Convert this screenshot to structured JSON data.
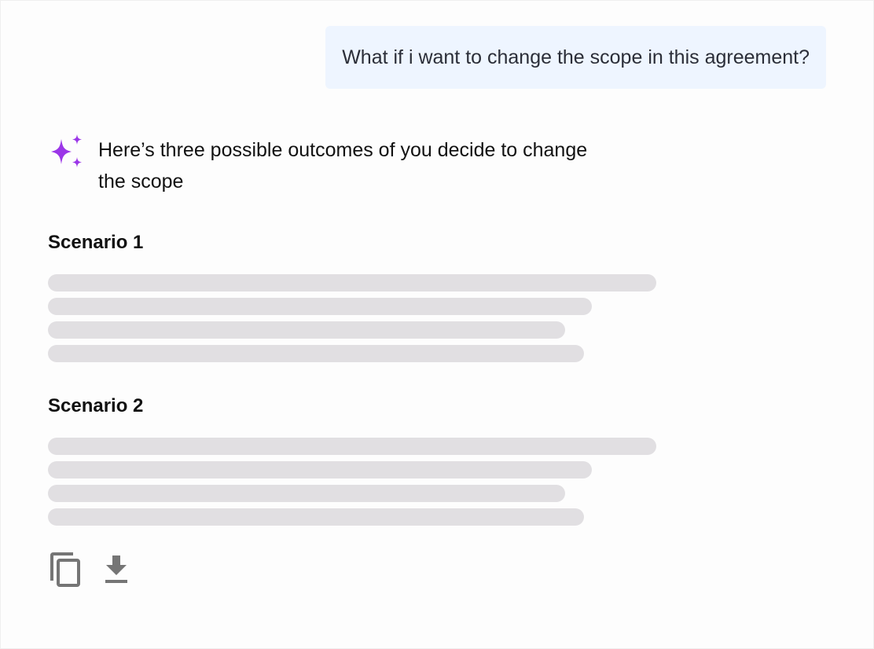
{
  "user_message": {
    "text": "What if i want to change the scope in this agreement?"
  },
  "assistant": {
    "icon": "sparkle-icon",
    "accent_color": "#9b36e8",
    "intro": "Here’s three possible outcomes of you decide to change the scope",
    "scenarios": [
      {
        "title": "Scenario 1",
        "loading": true
      },
      {
        "title": "Scenario 2",
        "loading": true
      }
    ]
  },
  "actions": [
    {
      "name": "copy",
      "icon": "copy-icon"
    },
    {
      "name": "download",
      "icon": "download-icon"
    }
  ]
}
